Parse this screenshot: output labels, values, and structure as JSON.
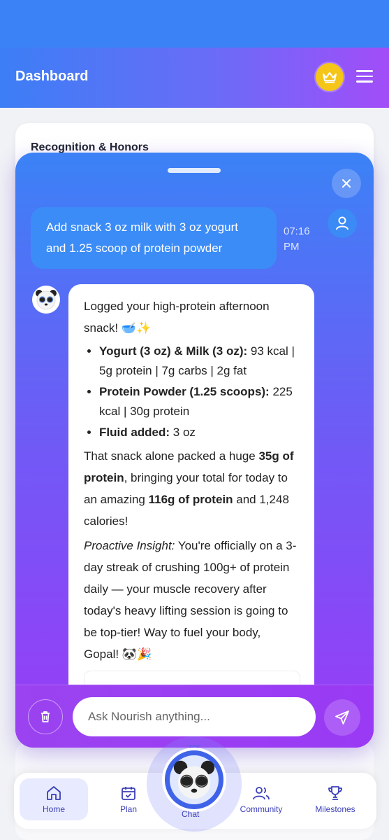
{
  "header": {
    "title": "Dashboard"
  },
  "background": {
    "card_title": "Recognition & Honors"
  },
  "chat": {
    "user_message": "Add snack 3 oz milk with 3 oz yogurt and 1.25 scoop of protein powder",
    "user_time": "07:16 PM",
    "bot": {
      "intro": "Logged your high-protein afternoon snack! 🥣✨",
      "items": [
        {
          "label": "Yogurt (3 oz) & Milk (3 oz):",
          "value": " 93 kcal | 5g protein | 7g carbs | 2g fat"
        },
        {
          "label": "Protein Powder (1.25 scoops):",
          "value": " 225 kcal | 30g protein"
        },
        {
          "label": "Fluid added:",
          "value": " 3 oz"
        }
      ],
      "para_a": "That snack alone packed a huge ",
      "para_b": "35g of protein",
      "para_c": ", bringing your total for today to an amazing ",
      "para_d": "116g of protein",
      "para_e": " and 1,248 calories!",
      "insight_label": "Proactive Insight:",
      "insight_text": " You're officially on a 3-day streak of crushing 100g+ of protein daily — your muscle recovery after today's heavy lifting session is going to be top-tier! Way to fuel your body, Gopal! 🐼🎉"
    },
    "input_placeholder": "Ask Nourish anything..."
  },
  "nav": {
    "items": [
      {
        "label": "Home",
        "icon": "home-icon"
      },
      {
        "label": "Plan",
        "icon": "calendar-check-icon"
      },
      {
        "label": "Chat",
        "icon": "panda-avatar"
      },
      {
        "label": "Community",
        "icon": "users-icon"
      },
      {
        "label": "Milestones",
        "icon": "trophy-icon"
      }
    ]
  },
  "colors": {
    "accent": "#3b82f6",
    "purple": "#9a3bf7",
    "crown": "#f5c518",
    "nav_text": "#3b3fb8"
  }
}
